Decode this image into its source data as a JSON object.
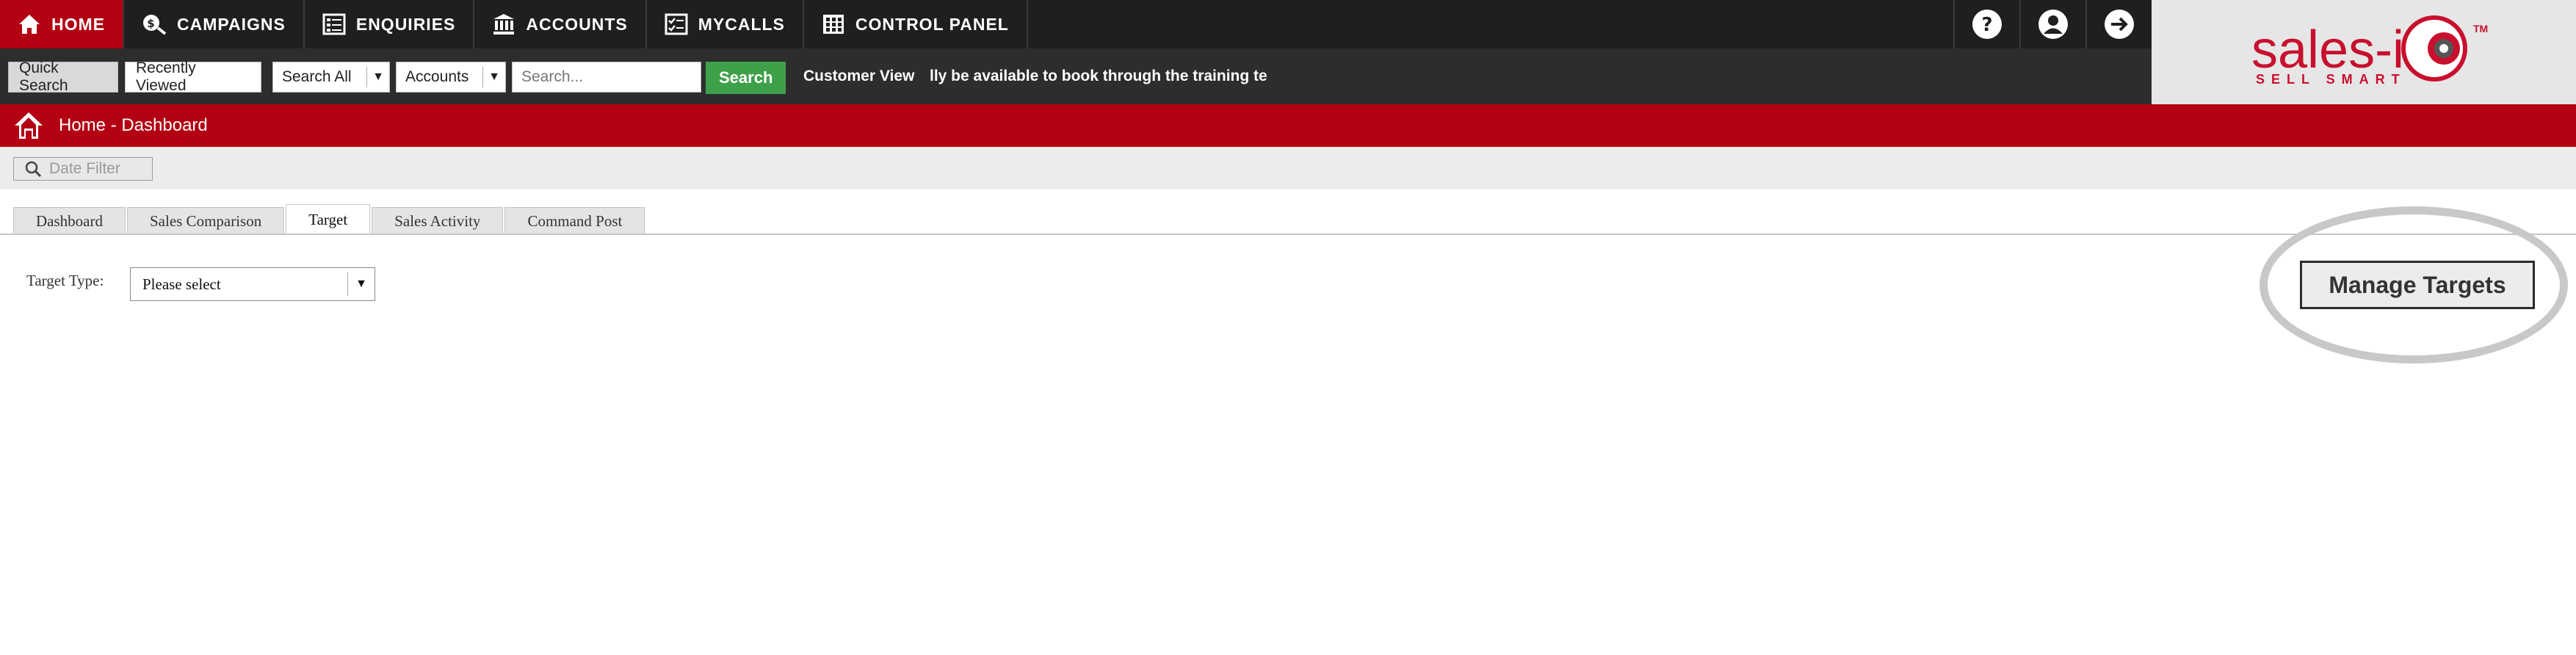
{
  "nav": {
    "items": [
      {
        "label": "HOME",
        "icon": "home-icon",
        "active": true
      },
      {
        "label": "CAMPAIGNS",
        "icon": "campaigns-icon",
        "active": false
      },
      {
        "label": "ENQUIRIES",
        "icon": "enquiries-icon",
        "active": false
      },
      {
        "label": "ACCOUNTS",
        "icon": "accounts-icon",
        "active": false
      },
      {
        "label": "MYCALLS",
        "icon": "mycalls-icon",
        "active": false
      },
      {
        "label": "CONTROL PANEL",
        "icon": "control-panel-icon",
        "active": false
      }
    ],
    "utility_icons": [
      "help-icon",
      "user-profile-icon",
      "logout-icon"
    ]
  },
  "logo": {
    "brand": "sales-i",
    "tagline": "SELL SMART",
    "trademark": "TM",
    "brand_color": "#c8102e"
  },
  "toolbar": {
    "quick_search": "Quick Search",
    "recently_viewed": "Recently Viewed",
    "search_scope": "Search All",
    "search_entity": "Accounts",
    "search_placeholder": "Search...",
    "search_button": "Search",
    "customer_view": "Customer View",
    "ticker_text": "lly be available to book through the training te"
  },
  "breadcrumb": {
    "text": "Home - Dashboard"
  },
  "filter": {
    "date_filter": "Date Filter"
  },
  "tabs": [
    {
      "label": "Dashboard",
      "active": false
    },
    {
      "label": "Sales Comparison",
      "active": false
    },
    {
      "label": "Target",
      "active": true
    },
    {
      "label": "Sales Activity",
      "active": false
    },
    {
      "label": "Command Post",
      "active": false
    }
  ],
  "target": {
    "type_label": "Target Type:",
    "type_value": "Please select",
    "manage_button": "Manage Targets"
  },
  "colors": {
    "accent_red": "#b30012",
    "nav_dark": "#1f1f1f",
    "toolbar_dark": "#2d2d2d",
    "search_green": "#3fa04a"
  }
}
